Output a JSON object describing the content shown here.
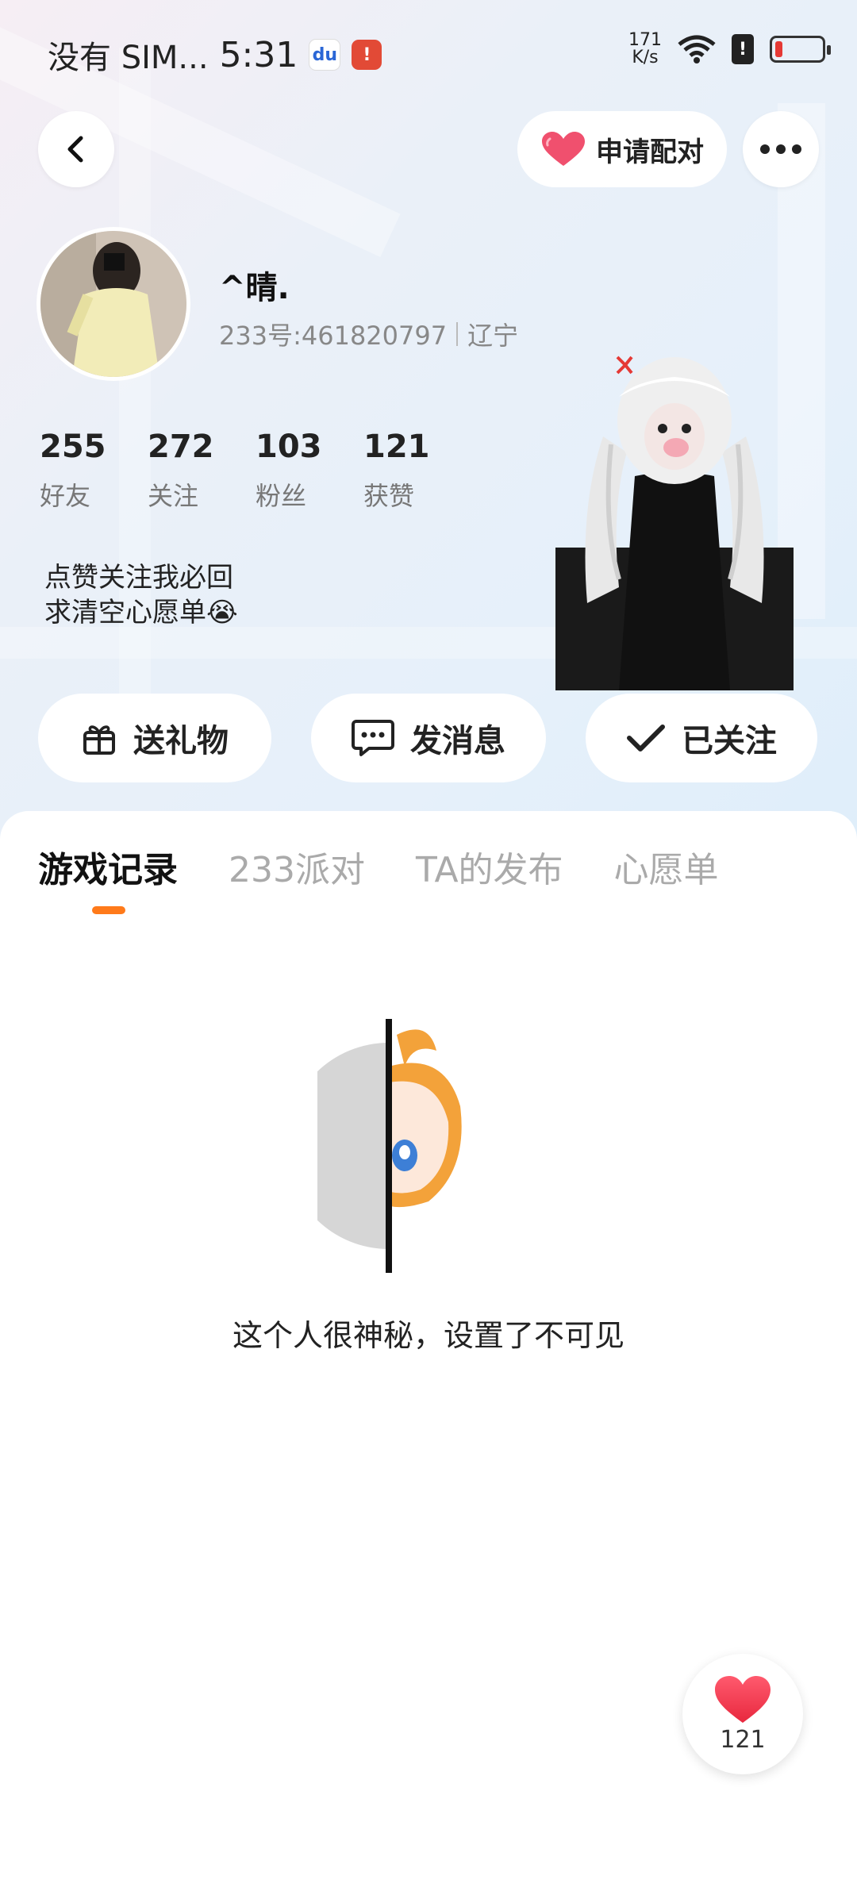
{
  "status_bar": {
    "carrier": "没有 SIM...",
    "time": "5:31",
    "baidu_icon": "du",
    "alert_badge": "!",
    "network_speed_value": "171",
    "network_speed_unit": "K/s",
    "sim_badge": "!"
  },
  "header": {
    "pair_label": "申请配对"
  },
  "profile": {
    "username": "^晴.",
    "user_id": "233号:461820797",
    "location": "辽宁",
    "stats": [
      {
        "num": "255",
        "label": "好友"
      },
      {
        "num": "272",
        "label": "关注"
      },
      {
        "num": "103",
        "label": "粉丝"
      },
      {
        "num": "121",
        "label": "获赞"
      }
    ],
    "bio": "点赞关注我必回\n求清空心愿单😭"
  },
  "actions": {
    "gift_label": "送礼物",
    "message_label": "发消息",
    "follow_label": "已关注"
  },
  "tabs": [
    {
      "label": "游戏记录",
      "active": true
    },
    {
      "label": "233派对",
      "active": false
    },
    {
      "label": "TA的发布",
      "active": false
    },
    {
      "label": "心愿单",
      "active": false
    }
  ],
  "empty_state": {
    "message": "这个人很神秘，设置了不可见"
  },
  "like_fab": {
    "count": "121"
  },
  "colors": {
    "accent": "#ff7a1a",
    "heart": "#f0506e"
  },
  "icons": [
    "back-icon",
    "heart-icon",
    "more-icon",
    "gift-icon",
    "chat-icon",
    "check-icon"
  ]
}
